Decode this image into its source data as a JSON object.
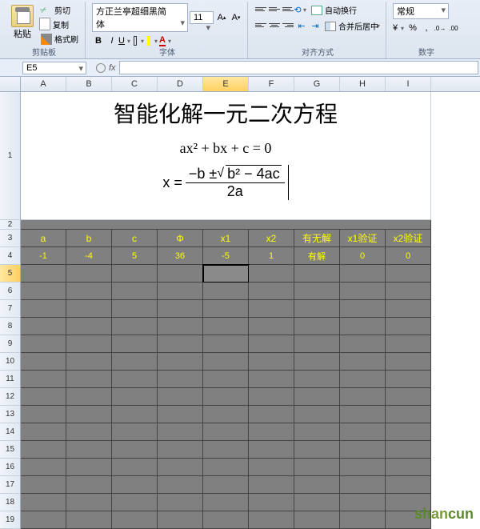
{
  "ribbon": {
    "clipboard": {
      "paste": "粘贴",
      "cut": "剪切",
      "copy": "复制",
      "format": "格式刷",
      "group": "剪贴板"
    },
    "font": {
      "name": "方正兰亭超细黑简体",
      "size": "11",
      "group": "字体"
    },
    "align": {
      "wrap": "自动换行",
      "merge": "合并后居中",
      "group": "对齐方式"
    },
    "number": {
      "format": "常规",
      "group": "数字"
    }
  },
  "namebox": "E5",
  "fx": "fx",
  "cols": [
    "A",
    "B",
    "C",
    "D",
    "E",
    "F",
    "G",
    "H",
    "I"
  ],
  "rows": [
    "1",
    "2",
    "3",
    "4",
    "5",
    "6",
    "7",
    "8",
    "9",
    "10",
    "11",
    "12",
    "13",
    "14",
    "15",
    "16",
    "17",
    "18",
    "19"
  ],
  "title": "智能化解一元二次方程",
  "eq1": "ax² + bx + c = 0",
  "eq2": {
    "lhs": "x = ",
    "num_pre": "−b ± ",
    "sq": "b² − 4ac",
    "den": "2a"
  },
  "headers": [
    "a",
    "b",
    "c",
    "Φ",
    "x1",
    "x2",
    "有无解",
    "x1验证",
    "x2验证"
  ],
  "values": [
    "-1",
    "-4",
    "5",
    "36",
    "-5",
    "1",
    "有解",
    "0",
    "0"
  ],
  "watermark": "shancun"
}
